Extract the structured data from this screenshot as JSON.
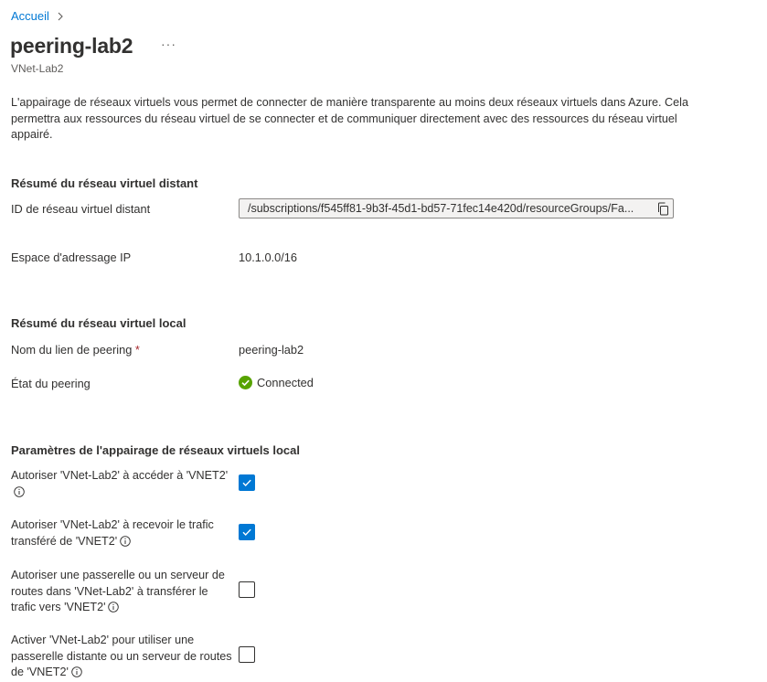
{
  "breadcrumb": {
    "home": "Accueil"
  },
  "header": {
    "title": "peering-lab2",
    "more": "···",
    "subtitle": "VNet-Lab2"
  },
  "description": "L'appairage de réseaux virtuels vous permet de connecter de manière transparente au moins deux réseaux virtuels dans Azure. Cela permettra aux ressources du réseau virtuel de se connecter et de communiquer directement avec des ressources du réseau virtuel appairé.",
  "remote": {
    "heading": "Résumé du réseau virtuel distant",
    "id_label": "ID de réseau virtuel distant",
    "id_value": "/subscriptions/f545ff81-9b3f-45d1-bd57-71fec14e420d/resourceGroups/Fa...",
    "address_label": "Espace d'adressage IP",
    "address_value": "10.1.0.0/16"
  },
  "local": {
    "heading": "Résumé du réseau virtuel local",
    "link_label": "Nom du lien de peering",
    "required_mark": "*",
    "link_value": "peering-lab2",
    "state_label": "État du peering",
    "state_value": "Connected",
    "state_color": "#57a300"
  },
  "settings": {
    "heading": "Paramètres de l'appairage de réseaux virtuels local",
    "options": [
      {
        "label": "Autoriser 'VNet-Lab2' à accéder à 'VNET2'",
        "checked": true
      },
      {
        "label": "Autoriser 'VNet-Lab2' à recevoir le trafic transféré de 'VNET2'",
        "checked": true
      },
      {
        "label": "Autoriser une passerelle ou un serveur de routes dans 'VNet-Lab2' à transférer le trafic vers 'VNET2'",
        "checked": false
      },
      {
        "label": "Activer 'VNet-Lab2' pour utiliser une passerelle distante ou un serveur de routes de 'VNET2'",
        "checked": false
      }
    ]
  },
  "colors": {
    "accent": "#0078d4",
    "text": "#323130",
    "required": "#a4262c"
  },
  "icons": {
    "breadcrumb_sep": "chevron-right-icon",
    "copy": "copy-icon",
    "status": "check-circle-icon",
    "info": "info-icon",
    "checkbox": "checkmark-icon"
  }
}
